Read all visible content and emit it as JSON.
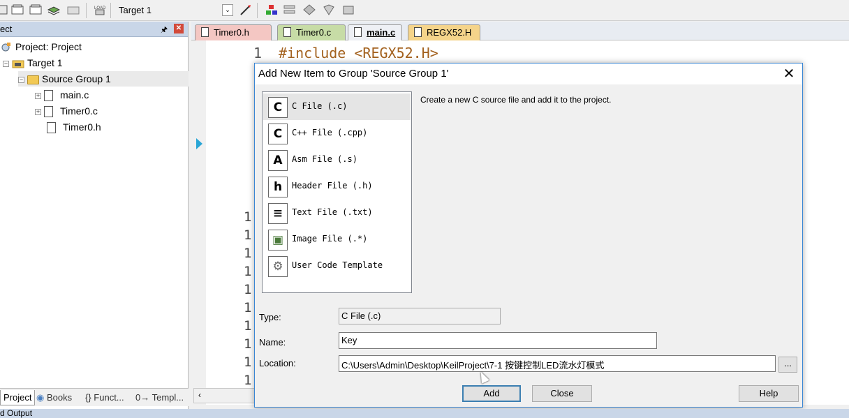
{
  "toolbar": {
    "target": "Target 1",
    "icons": [
      "new-project-icon",
      "open-icon",
      "save-all-icon",
      "layers-icon",
      "batch-icon",
      "load-icon",
      "target-options-icon",
      "magic-wand-icon",
      "manage-components-icon",
      "select-software-packs-icon",
      "pack-installer-icon",
      "manage-runtime-icon",
      "run-icon"
    ]
  },
  "project_panel": {
    "title": "ect",
    "project": "Project: Project",
    "target": "Target 1",
    "group": "Source Group 1",
    "files": [
      "main.c",
      "Timer0.c",
      "Timer0.h"
    ]
  },
  "bottom_tabs": [
    "Project",
    "Books",
    "{} Funct...",
    "0→ Templ..."
  ],
  "editor": {
    "tabs": [
      {
        "label": "Timer0.h",
        "color": "#f4c7c3"
      },
      {
        "label": "Timer0.c",
        "color": "#c7dca6"
      },
      {
        "label": "main.c",
        "color": "#eef0f5"
      },
      {
        "label": "REGX52.H",
        "color": "#f5d48a"
      }
    ],
    "line1_number": "1",
    "line1_code": "#include <REGX52.H>",
    "line_numbers": [
      "1",
      "1",
      "1",
      "1",
      "1",
      "1",
      "1",
      "1",
      "1",
      "1"
    ]
  },
  "dialog": {
    "title": "Add New Item to Group 'Source Group 1'",
    "types": [
      {
        "icon": "C",
        "label": "C File (.c)"
      },
      {
        "icon": "C",
        "label": "C++ File (.cpp)"
      },
      {
        "icon": "A",
        "label": "Asm File (.s)"
      },
      {
        "icon": "h",
        "label": "Header File (.h)"
      },
      {
        "icon": "≡",
        "label": "Text File (.txt)"
      },
      {
        "icon": "▣",
        "label": "Image File (.*)"
      },
      {
        "icon": "⚙",
        "label": "User Code Template"
      }
    ],
    "description": "Create a new C source file and add it to the project.",
    "type_label": "Type:",
    "type_value": "C File (.c)",
    "name_label": "Name:",
    "name_value": "Key",
    "location_label": "Location:",
    "location_value": "C:\\Users\\Admin\\Desktop\\KeilProject\\7-1 按键控制LED流水灯模式",
    "browse_label": "...",
    "add_label": "Add",
    "close_label": "Close",
    "help_label": "Help"
  },
  "status": {
    "label": "d Output"
  }
}
